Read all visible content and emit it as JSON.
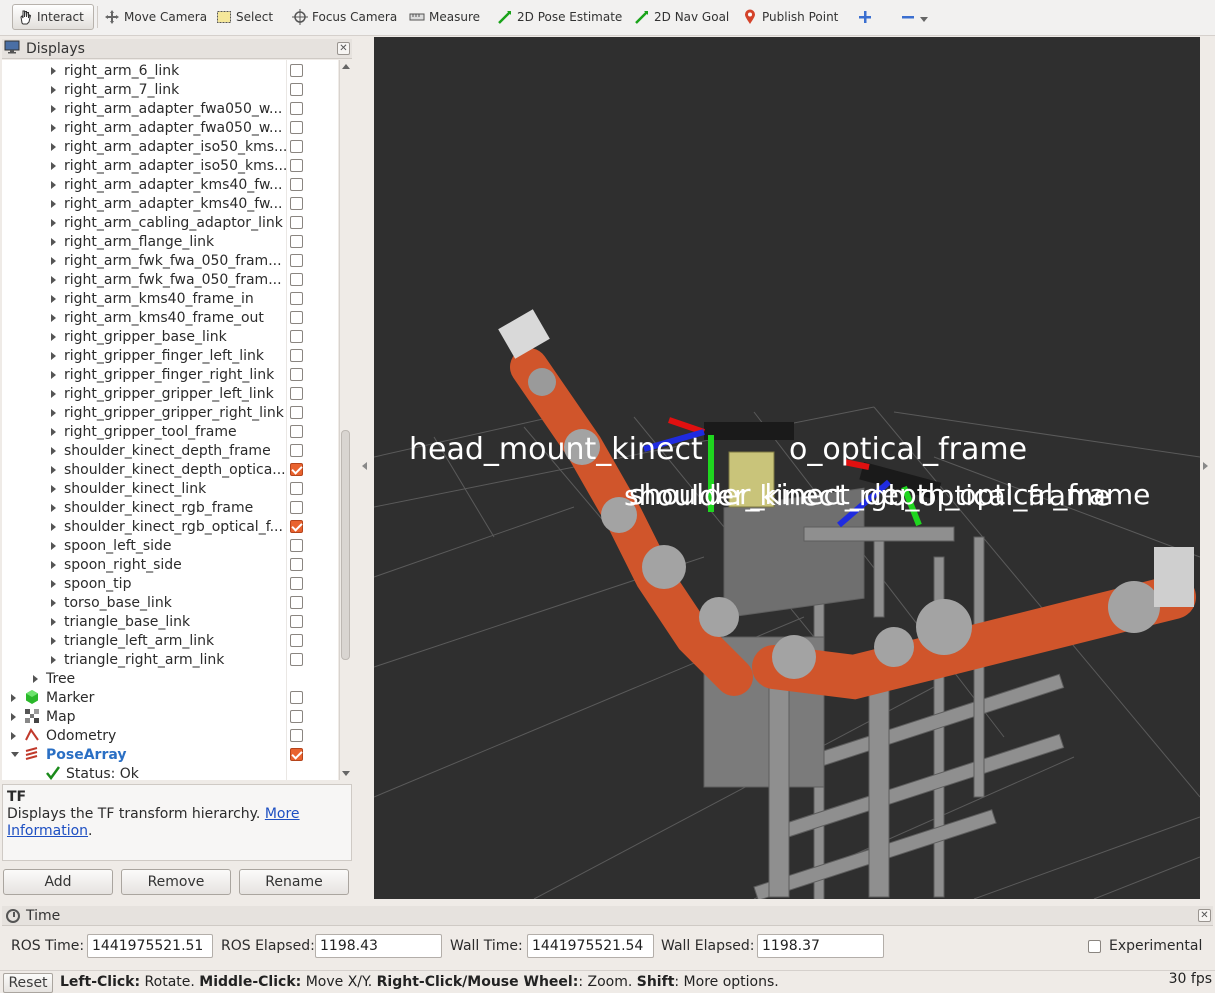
{
  "toolbar": {
    "tools": [
      {
        "label": "Interact",
        "icon": "hand-icon"
      },
      {
        "label": "Move Camera",
        "icon": "move-camera-icon"
      },
      {
        "label": "Select",
        "icon": "select-icon"
      },
      {
        "label": "Focus Camera",
        "icon": "focus-camera-icon"
      },
      {
        "label": "Measure",
        "icon": "measure-icon"
      },
      {
        "label": "2D Pose Estimate",
        "icon": "pose-estimate-icon"
      },
      {
        "label": "2D Nav Goal",
        "icon": "nav-goal-icon"
      },
      {
        "label": "Publish Point",
        "icon": "publish-point-icon"
      }
    ]
  },
  "displays": {
    "title": "Displays",
    "frames": [
      {
        "label": "right_arm_6_link",
        "checked": false
      },
      {
        "label": "right_arm_7_link",
        "checked": false
      },
      {
        "label": "right_arm_adapter_fwa050_w...",
        "checked": false
      },
      {
        "label": "right_arm_adapter_fwa050_w...",
        "checked": false
      },
      {
        "label": "right_arm_adapter_iso50_kms...",
        "checked": false
      },
      {
        "label": "right_arm_adapter_iso50_kms...",
        "checked": false
      },
      {
        "label": "right_arm_adapter_kms40_fw...",
        "checked": false
      },
      {
        "label": "right_arm_adapter_kms40_fw...",
        "checked": false
      },
      {
        "label": "right_arm_cabling_adaptor_link",
        "checked": false
      },
      {
        "label": "right_arm_flange_link",
        "checked": false
      },
      {
        "label": "right_arm_fwk_fwa_050_fram...",
        "checked": false
      },
      {
        "label": "right_arm_fwk_fwa_050_fram...",
        "checked": false
      },
      {
        "label": "right_arm_kms40_frame_in",
        "checked": false
      },
      {
        "label": "right_arm_kms40_frame_out",
        "checked": false
      },
      {
        "label": "right_gripper_base_link",
        "checked": false
      },
      {
        "label": "right_gripper_finger_left_link",
        "checked": false
      },
      {
        "label": "right_gripper_finger_right_link",
        "checked": false
      },
      {
        "label": "right_gripper_gripper_left_link",
        "checked": false
      },
      {
        "label": "right_gripper_gripper_right_link",
        "checked": false
      },
      {
        "label": "right_gripper_tool_frame",
        "checked": false
      },
      {
        "label": "shoulder_kinect_depth_frame",
        "checked": false
      },
      {
        "label": "shoulder_kinect_depth_optica...",
        "checked": true
      },
      {
        "label": "shoulder_kinect_link",
        "checked": false
      },
      {
        "label": "shoulder_kinect_rgb_frame",
        "checked": false
      },
      {
        "label": "shoulder_kinect_rgb_optical_f...",
        "checked": true
      },
      {
        "label": "spoon_left_side",
        "checked": false
      },
      {
        "label": "spoon_right_side",
        "checked": false
      },
      {
        "label": "spoon_tip",
        "checked": false
      },
      {
        "label": "torso_base_link",
        "checked": false
      },
      {
        "label": "triangle_base_link",
        "checked": false
      },
      {
        "label": "triangle_left_arm_link",
        "checked": false
      },
      {
        "label": "triangle_right_arm_link",
        "checked": false
      }
    ],
    "tree_label": "Tree",
    "marker_label": "Marker",
    "map_label": "Map",
    "odometry_label": "Odometry",
    "posearray_label": "PoseArray",
    "status_label": "Status: Ok"
  },
  "description": {
    "title": "TF",
    "text": "Displays the TF transform hierarchy.",
    "link1": "More",
    "link2": "Information",
    "tail": "."
  },
  "buttons": {
    "add": "Add",
    "remove": "Remove",
    "rename": "Rename"
  },
  "viewport": {
    "label1": "head_mount_kinect2_rgb_optical_frame",
    "label2": "shoulder_kinect_depth_optical_frame",
    "label3": "shoulder_kinect_rgb_optical_frame",
    "shown_label1": "head_mount_kinect",
    "shown_label1b": "o_optical_frame",
    "shown_label2": "shoulder_kinect_depth_optical_frame",
    "shown_label3": "shoulder_kinect_rgb_optical_frame"
  },
  "time": {
    "title": "Time",
    "ros_time_label": "ROS Time:",
    "ros_time": "1441975521.51",
    "ros_elapsed_label": "ROS Elapsed:",
    "ros_elapsed": "1198.43",
    "wall_time_label": "Wall Time:",
    "wall_time": "1441975521.54",
    "wall_elapsed_label": "Wall Elapsed:",
    "wall_elapsed": "1198.37",
    "experimental_label": "Experimental"
  },
  "status": {
    "reset": "Reset",
    "left_click": "Left-Click:",
    "left_click_text": " Rotate. ",
    "middle_click": "Middle-Click:",
    "middle_click_text": " Move X/Y. ",
    "right_click": "Right-Click/Mouse Wheel:",
    "right_click_text": ": Zoom. ",
    "shift": "Shift",
    "shift_text": ": More options.",
    "fps": "30 fps"
  }
}
